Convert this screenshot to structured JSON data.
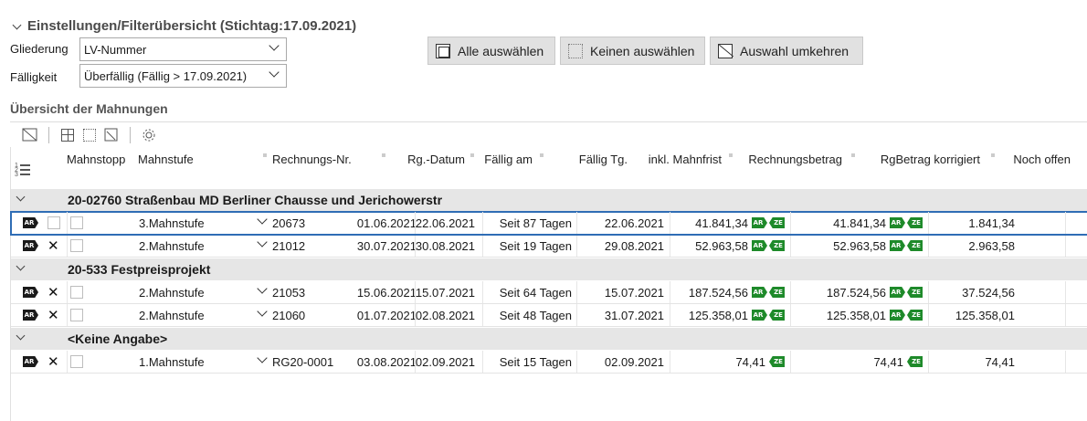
{
  "settings": {
    "title": "Einstellungen/Filterübersicht (Stichtag:17.09.2021)",
    "gliederung_label": "Gliederung",
    "gliederung_value": "LV-Nummer",
    "faelligkeit_label": "Fälligkeit",
    "faelligkeit_value": "Überfällig (Fällig > 17.09.2021)"
  },
  "buttons": {
    "select_all": "Alle auswählen",
    "select_none": "Keinen auswählen",
    "invert": "Auswahl umkehren"
  },
  "overview": {
    "title": "Übersicht der Mahnungen"
  },
  "columns": {
    "mahnstopp": "Mahnstopp",
    "mahnstufe": "Mahnstufe",
    "rechnungsnr": "Rechnungs-Nr.",
    "rgdatum": "Rg.-Datum",
    "faellig_am": "Fällig am",
    "faellig_tg": "Fällig Tg.",
    "inkl_mahnfrist": "inkl. Mahnfrist",
    "rechnungsbetrag": "Rechnungsbetrag",
    "rgbetrag_korr": "RgBetrag korrigiert",
    "noch_offen": "Noch offen"
  },
  "badges": {
    "ar": "AR",
    "ze": "ZE"
  },
  "groups": [
    {
      "title": "20-02760 Straßenbau MD  Berliner Chausse und Jerichowerstr",
      "rows": [
        {
          "mahnstufe": "3.Mahnstufe",
          "nr": "20673",
          "rgdatum": "01.06.2021",
          "faellig": "22.06.2021",
          "tage": "Seit 87 Tagen",
          "mahnfrist": "22.06.2021",
          "betrag": "41.841,34",
          "korrigiert": "41.841,34",
          "offen": "1.841,34"
        },
        {
          "mahnstufe": "2.Mahnstufe",
          "nr": "21012",
          "rgdatum": "30.07.2021",
          "faellig": "30.08.2021",
          "tage": "Seit 19 Tagen",
          "mahnfrist": "29.08.2021",
          "betrag": "52.963,58",
          "korrigiert": "52.963,58",
          "offen": "2.963,58"
        }
      ]
    },
    {
      "title": "20-533 Festpreisprojekt",
      "rows": [
        {
          "mahnstufe": "2.Mahnstufe",
          "nr": "21053",
          "rgdatum": "15.06.2021",
          "faellig": "15.07.2021",
          "tage": "Seit 64 Tagen",
          "mahnfrist": "15.07.2021",
          "betrag": "187.524,56",
          "korrigiert": "187.524,56",
          "offen": "37.524,56"
        },
        {
          "mahnstufe": "2.Mahnstufe",
          "nr": "21060",
          "rgdatum": "01.07.2021",
          "faellig": "02.08.2021",
          "tage": "Seit 48 Tagen",
          "mahnfrist": "31.07.2021",
          "betrag": "125.358,01",
          "korrigiert": "125.358,01",
          "offen": "125.358,01"
        }
      ]
    },
    {
      "title": "<Keine Angabe>",
      "rows": [
        {
          "mahnstufe": "1.Mahnstufe",
          "nr": "RG20-0001",
          "rgdatum": "03.08.2021",
          "faellig": "02.09.2021",
          "tage": "Seit 15 Tagen",
          "mahnfrist": "02.09.2021",
          "betrag": "74,41",
          "korrigiert": "74,41",
          "offen": "74,41"
        }
      ]
    }
  ]
}
